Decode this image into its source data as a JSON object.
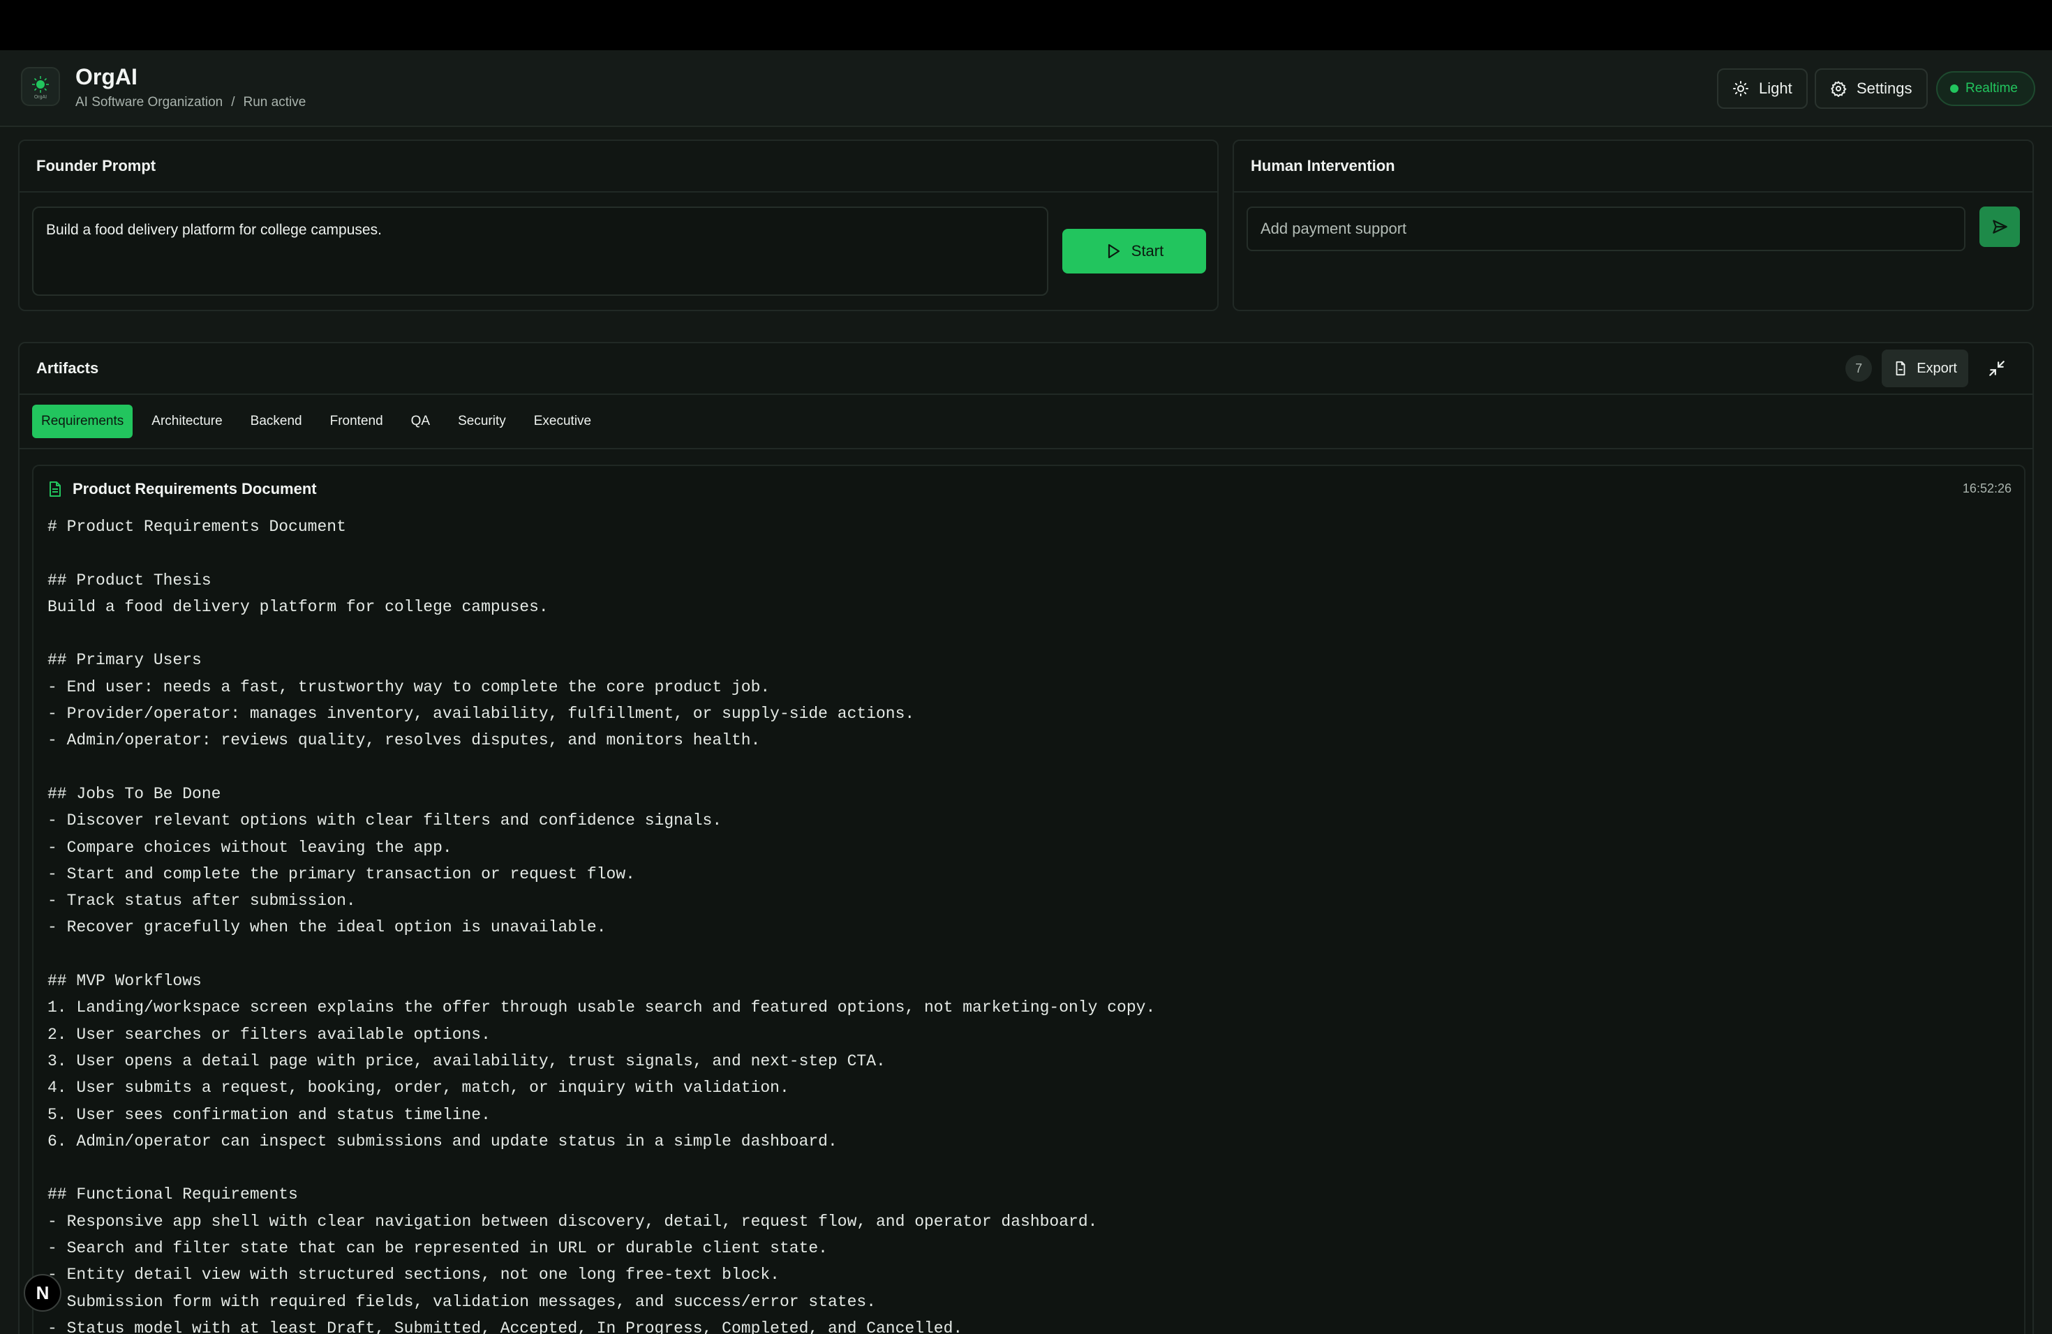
{
  "header": {
    "title": "OrgAI",
    "logo_text": "OrgAI",
    "breadcrumb": [
      "AI Software Organization",
      "/",
      "Run active"
    ],
    "theme_label": "Light",
    "settings_label": "Settings",
    "status_label": "Realtime",
    "status_color": "#22c55e"
  },
  "founder": {
    "title": "Founder Prompt",
    "prompt": "Build a food delivery platform for college campuses.",
    "start_label": "Start"
  },
  "intervention": {
    "title": "Human Intervention",
    "placeholder": "Add payment support"
  },
  "artifacts": {
    "title": "Artifacts",
    "count": "7",
    "export_label": "Export",
    "tabs": [
      "Requirements",
      "Architecture",
      "Backend",
      "Frontend",
      "QA",
      "Security",
      "Executive"
    ],
    "active_tab": "Requirements",
    "doc": {
      "title": "Product Requirements Document",
      "time": "16:52:26",
      "lines": [
        "# Product Requirements Document",
        "",
        "## Product Thesis",
        "Build a food delivery platform for college campuses.",
        "",
        "## Primary Users",
        "- End user: needs a fast, trustworthy way to complete the core product job.",
        "- Provider/operator: manages inventory, availability, fulfillment, or supply-side actions.",
        "- Admin/operator: reviews quality, resolves disputes, and monitors health.",
        "",
        "## Jobs To Be Done",
        "- Discover relevant options with clear filters and confidence signals.",
        "- Compare choices without leaving the app.",
        "- Start and complete the primary transaction or request flow.",
        "- Track status after submission.",
        "- Recover gracefully when the ideal option is unavailable.",
        "",
        "## MVP Workflows",
        "1. Landing/workspace screen explains the offer through usable search and featured options, not marketing-only copy.",
        "2. User searches or filters available options.",
        "3. User opens a detail page with price, availability, trust signals, and next-step CTA.",
        "4. User submits a request, booking, order, match, or inquiry with validation.",
        "5. User sees confirmation and status timeline.",
        "6. Admin/operator can inspect submissions and update status in a simple dashboard.",
        "",
        "## Functional Requirements",
        "- Responsive app shell with clear navigation between discovery, detail, request flow, and operator dashboard.",
        "- Search and filter state that can be represented in URL or durable client state.",
        "- Entity detail view with structured sections, not one long free-text block.",
        "- Submission form with required fields, validation messages, and success/error states.",
        "- Status model with at least Draft, Submitted, Accepted, In Progress, Completed, and Cancelled."
      ]
    }
  },
  "floating_badge": "N"
}
